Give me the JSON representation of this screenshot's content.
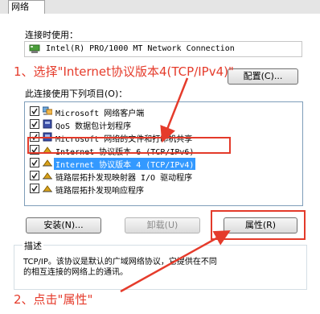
{
  "tab": {
    "label": "网络"
  },
  "connect_using": {
    "label": "连接时使用：",
    "adapter": "Intel(R) PRO/1000 MT Network Connection",
    "configure_button": "配置(C)..."
  },
  "items_label": "此连接使用下列项目(O)：",
  "items": [
    {
      "label": "Microsoft 网络客户端",
      "icon": "network-client-icon",
      "checked": true
    },
    {
      "label": "QoS 数据包计划程序",
      "icon": "qos-icon",
      "checked": true
    },
    {
      "label": "Microsoft 网络的文件和打印机共享",
      "icon": "file-printer-sharing-icon",
      "checked": true
    },
    {
      "label": "Internet 协议版本 6 (TCP/IPv6)",
      "icon": "protocol-icon",
      "checked": true
    },
    {
      "label": "Internet 协议版本 4 (TCP/IPv4)",
      "icon": "protocol-icon",
      "checked": true,
      "selected": true
    },
    {
      "label": "链路层拓扑发现映射器 I/O 驱动程序",
      "icon": "protocol-icon",
      "checked": true
    },
    {
      "label": "链路层拓扑发现响应程序",
      "icon": "protocol-icon",
      "checked": true
    }
  ],
  "buttons": {
    "install": "安装(N)...",
    "uninstall": "卸载(U)",
    "properties": "属性(R)"
  },
  "description": {
    "title": "描述",
    "text_line1": "TCP/IP。该协议是默认的广域网络协议，它提供在不同",
    "text_line2": "的相互连接的网络上的通讯。"
  },
  "annotations": {
    "step1": "1、选择\"Internet协议版本4(TCP/IPv4)\"",
    "step2": "2、点击\"属性\""
  },
  "colors": {
    "annotation": "#e53b2b",
    "selection": "#3399ff"
  }
}
